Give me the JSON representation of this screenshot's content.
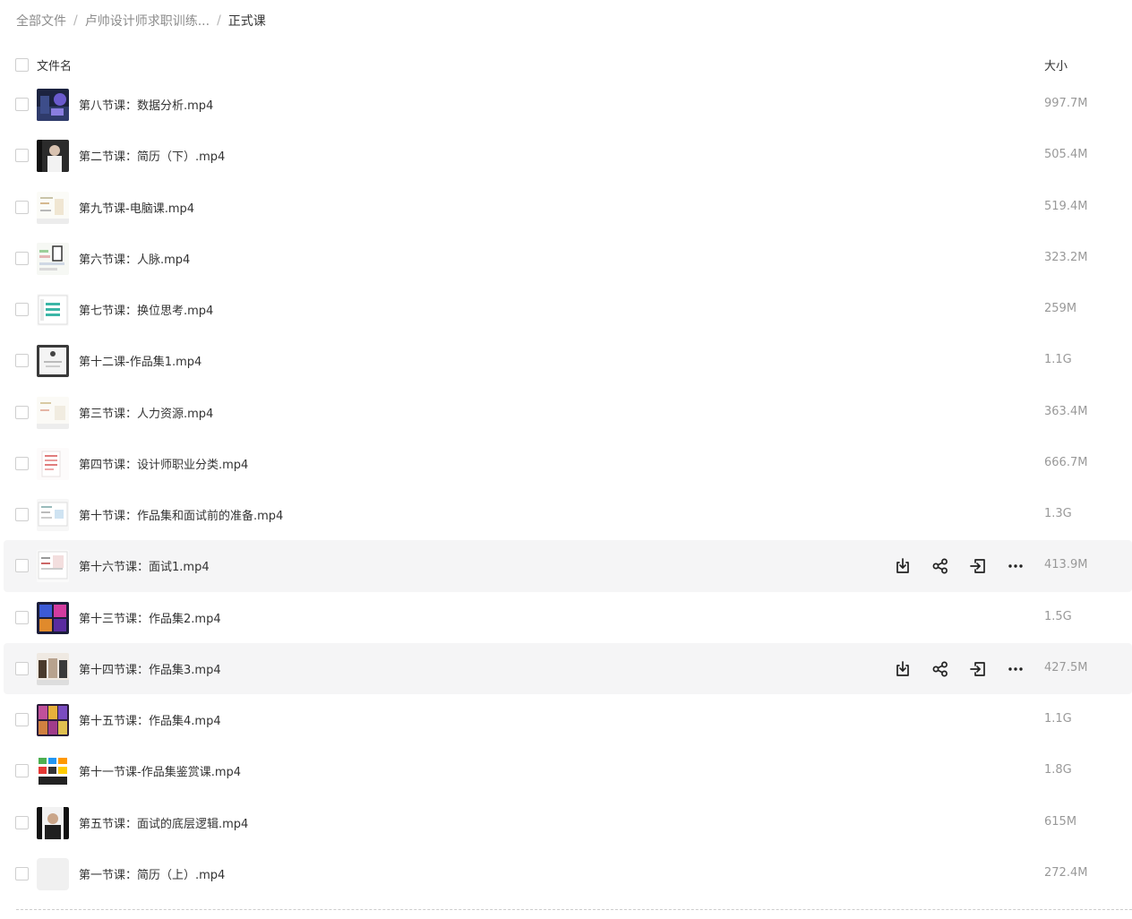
{
  "breadcrumb": {
    "root": "全部文件",
    "parent": "卢帅设计师求职训练...",
    "current": "正式课",
    "separator": "/"
  },
  "header": {
    "name_label": "文件名",
    "size_label": "大小"
  },
  "files": [
    {
      "name": "第八节课：数据分析.mp4",
      "size": "997.7M"
    },
    {
      "name": "第二节课：简历（下）.mp4",
      "size": "505.4M"
    },
    {
      "name": "第九节课-电脑课.mp4",
      "size": "519.4M"
    },
    {
      "name": "第六节课：人脉.mp4",
      "size": "323.2M"
    },
    {
      "name": "第七节课：换位思考.mp4",
      "size": "259M"
    },
    {
      "name": "第十二课-作品集1.mp4",
      "size": "1.1G"
    },
    {
      "name": "第三节课：人力资源.mp4",
      "size": "363.4M"
    },
    {
      "name": "第四节课：设计师职业分类.mp4",
      "size": "666.7M"
    },
    {
      "name": "第十节课：作品集和面试前的准备.mp4",
      "size": "1.3G"
    },
    {
      "name": "第十六节课：面试1.mp4",
      "size": "413.9M"
    },
    {
      "name": "第十三节课：作品集2.mp4",
      "size": "1.5G"
    },
    {
      "name": "第十四节课：作品集3.mp4",
      "size": "427.5M"
    },
    {
      "name": "第十五节课：作品集4.mp4",
      "size": "1.1G"
    },
    {
      "name": "第十一节课-作品集鉴赏课.mp4",
      "size": "1.8G"
    },
    {
      "name": "第五节课：面试的底层逻辑.mp4",
      "size": "615M"
    },
    {
      "name": "第一节课：简历（上）.mp4",
      "size": "272.4M"
    }
  ],
  "row_actions": [
    "download-icon",
    "share-icon",
    "move-icon",
    "more-icon"
  ],
  "colors": {
    "text": "#333333",
    "muted": "#999999",
    "hover_row": "#f5f5f6",
    "icon": "#222222"
  }
}
